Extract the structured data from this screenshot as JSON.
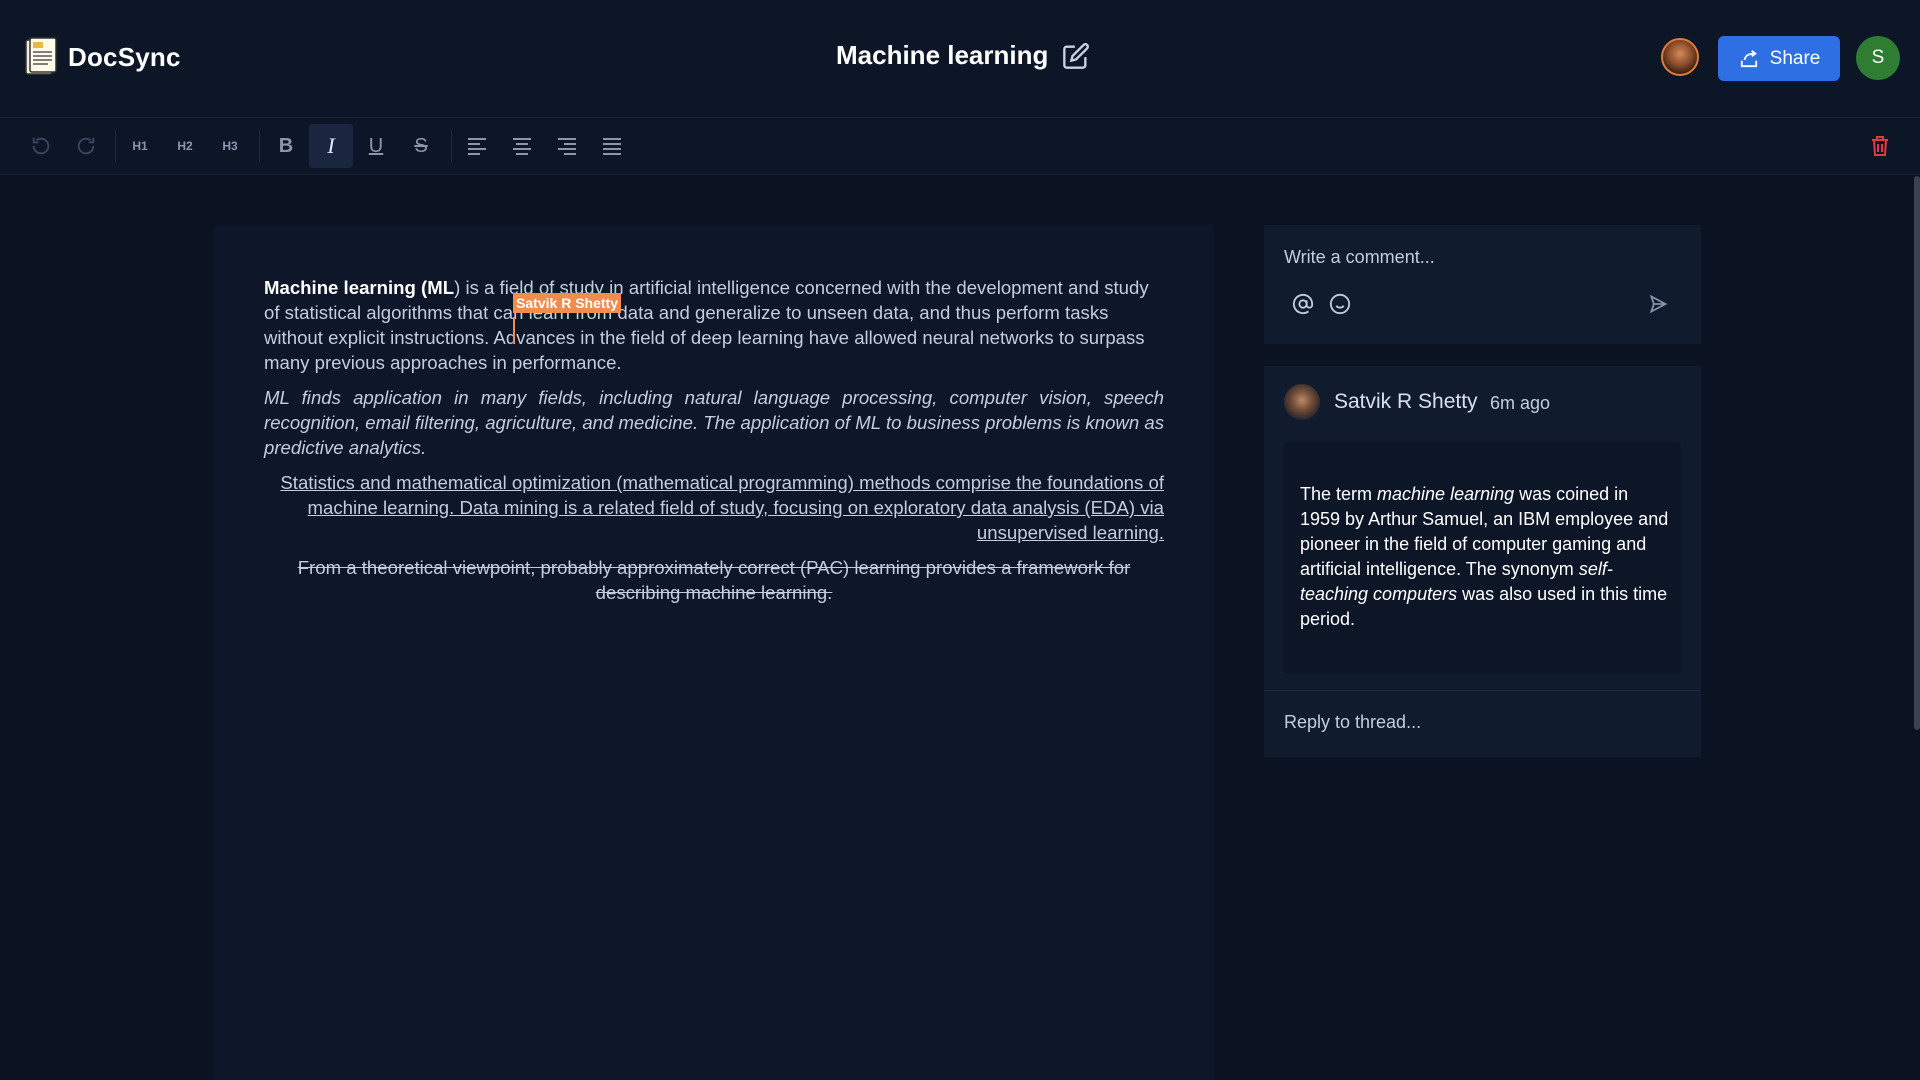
{
  "header": {
    "app_name": "DocSync",
    "doc_title": "Machine learning",
    "share_label": "Share",
    "user_initial": "S"
  },
  "toolbar": {
    "undo": "undo-icon",
    "redo": "redo-icon",
    "h1": "H1",
    "h2": "H2",
    "h3": "H3",
    "bold": "B",
    "italic": "I",
    "underline": "U",
    "strike": "S"
  },
  "editor": {
    "p1_strong": "Machine learning (ML",
    "p1_a": ") is a field of study in artificial intelligence concerned with the development and study of statistical algorithms that ca",
    "p1_b": "n learn from data and generalize to unseen data, and thus perform tasks without explicit instructions. Advances in the field of deep learning have allowed neural networks to surpass many previous approaches in performance.",
    "p2": "ML finds application in many fields, including natural language processing, computer vision, speech recognition, email filtering, agriculture, and medicine. The application of ML to business problems is known as predictive analytics.",
    "p3": "Statistics and mathematical optimization (mathematical programming) methods comprise the foundations of machine learning. Data mining is a related field of study, focusing on exploratory data analysis (EDA) via unsupervised learning.",
    "p4": "From a theoretical viewpoint, probably approximately correct (PAC) learning provides a framework for describing machine learning.",
    "collab_cursor_name": "Satvik R Shetty"
  },
  "comments": {
    "input_placeholder": "Write a comment...",
    "thread": {
      "author": "Satvik R Shetty",
      "time": "6m ago",
      "text_1": "The term ",
      "text_i1": "machine learning",
      "text_2": " was coined in 1959 by Arthur Samuel, an IBM employee and pioneer in the field of computer gaming and artificial intelligence. The synonym ",
      "text_i2": "self-teaching computers",
      "text_3": " was also used in this time period."
    },
    "reply_placeholder": "Reply to thread..."
  },
  "colors": {
    "accent": "#2f6fe4",
    "cursor": "#f08c4e",
    "delete": "#e23b3b",
    "background": "#0b1322"
  }
}
